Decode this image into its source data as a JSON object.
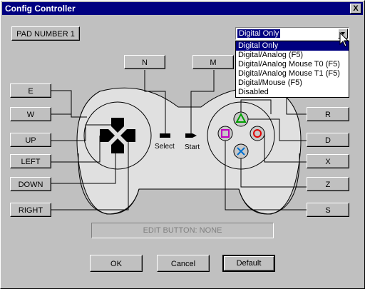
{
  "window": {
    "title": "Config Controller",
    "close_label": "X"
  },
  "pad_number": "PAD NUMBER 1",
  "mode_select": {
    "value": "Digital Only",
    "options": [
      "Digital Only",
      "Digital/Analog (F5)",
      "Digital/Analog Mouse T0 (F5)",
      "Digital/Analog Mouse T1 (F5)",
      "Digital/Mouse  (F5)",
      "Disabled"
    ],
    "highlighted_index": 0
  },
  "mappings": {
    "l1": "N",
    "l2": "M",
    "left_e": "E",
    "left_w": "W",
    "up": "UP",
    "left": "LEFT",
    "down": "DOWN",
    "right": "RIGHT",
    "r": "R",
    "triangle": "D",
    "cross": "X",
    "circle": "Z",
    "square": "S"
  },
  "controller_labels": {
    "select": "Select",
    "start": "Start"
  },
  "edit_status": "EDIT BUTTON: NONE",
  "buttons": {
    "ok": "OK",
    "cancel": "Cancel",
    "default": "Default"
  },
  "colors": {
    "titlebar": "#000080",
    "triangle": "#00a000",
    "circle": "#e00000",
    "square": "#c000c0",
    "cross": "#0070d0"
  }
}
